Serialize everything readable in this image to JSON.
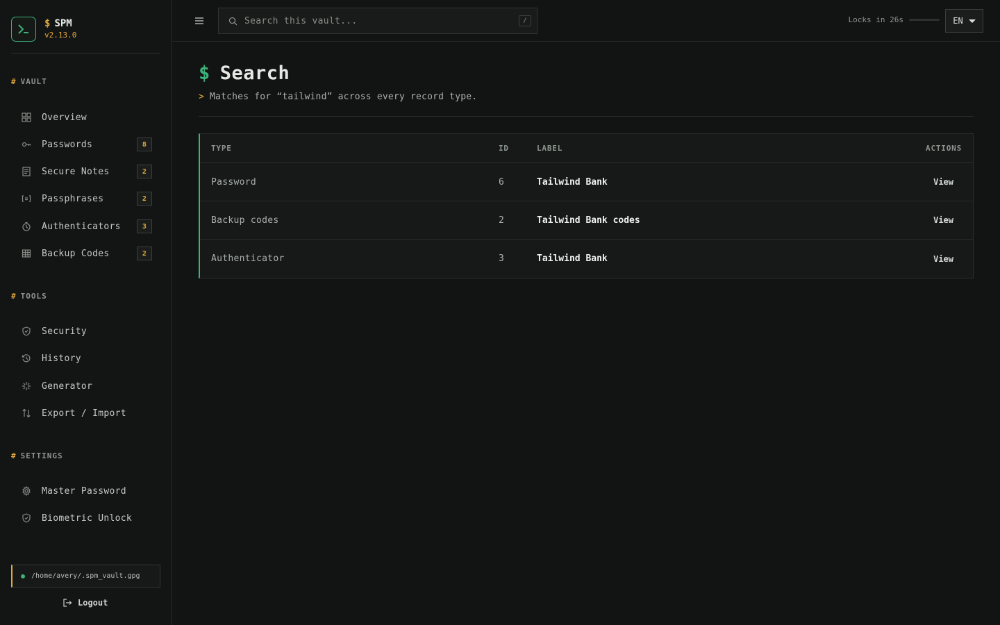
{
  "app": {
    "name": "SPM",
    "name_prefix": "$",
    "version": "v2.13.0"
  },
  "sidebar": {
    "sections": [
      {
        "title": "VAULT",
        "hash": "#"
      },
      {
        "title": "TOOLS",
        "hash": "#"
      },
      {
        "title": "SETTINGS",
        "hash": "#"
      }
    ],
    "vault_items": [
      {
        "label": "Overview",
        "icon": "grid-icon"
      },
      {
        "label": "Passwords",
        "icon": "key-icon",
        "count": "8"
      },
      {
        "label": "Secure Notes",
        "icon": "note-icon",
        "count": "2"
      },
      {
        "label": "Passphrases",
        "icon": "passphrase-icon",
        "count": "2"
      },
      {
        "label": "Authenticators",
        "icon": "timer-icon",
        "count": "3"
      },
      {
        "label": "Backup Codes",
        "icon": "table-icon",
        "count": "2"
      }
    ],
    "tools_items": [
      {
        "label": "Security",
        "icon": "shield-icon"
      },
      {
        "label": "History",
        "icon": "history-icon"
      },
      {
        "label": "Generator",
        "icon": "sparkle-icon"
      },
      {
        "label": "Export / Import",
        "icon": "arrows-updown-icon"
      }
    ],
    "settings_items": [
      {
        "label": "Master Password",
        "icon": "gear-icon"
      },
      {
        "label": "Biometric Unlock",
        "icon": "shield-icon"
      }
    ],
    "vault_path": "/home/avery/.spm_vault.gpg",
    "logout_label": "Logout"
  },
  "topbar": {
    "search_placeholder": "Search this vault...",
    "search_shortcut": "/",
    "lock_text": "Locks in 26s",
    "lock_progress": 0.0,
    "language": "EN"
  },
  "main": {
    "title_prefix": "$",
    "title": "Search",
    "subtitle_prefix": ">",
    "subtitle": "Matches for “tailwind” across every record type.",
    "table": {
      "headers": {
        "type": "TYPE",
        "id": "ID",
        "label": "LABEL",
        "actions": "ACTIONS"
      },
      "rows": [
        {
          "type": "Password",
          "id": "6",
          "label": "Tailwind Bank",
          "action": "View"
        },
        {
          "type": "Backup codes",
          "id": "2",
          "label": "Tailwind Bank codes",
          "action": "View"
        },
        {
          "type": "Authenticator",
          "id": "3",
          "label": "Tailwind Bank",
          "action": "View"
        }
      ]
    }
  },
  "colors": {
    "accent_green": "#3fb07a",
    "accent_amber": "#e3a93b",
    "background": "#121413"
  }
}
